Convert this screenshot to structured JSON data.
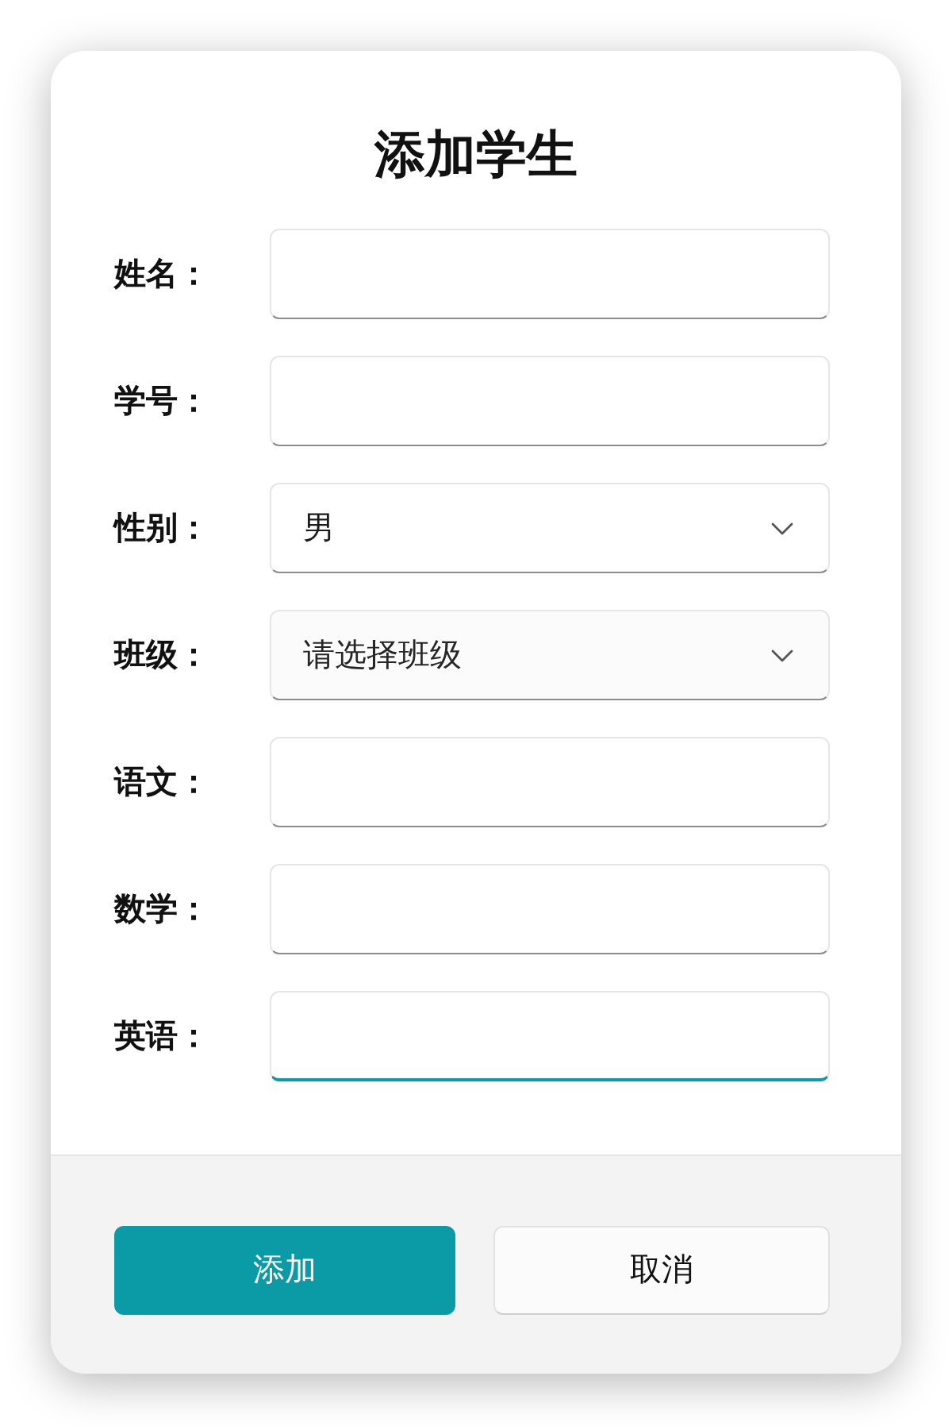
{
  "dialog": {
    "title": "添加学生"
  },
  "fields": [
    {
      "kind": "text",
      "label": "姓名：",
      "focused": false
    },
    {
      "kind": "text",
      "label": "学号：",
      "focused": false
    },
    {
      "kind": "select",
      "label": "性别：",
      "value": "男",
      "focused": false
    },
    {
      "kind": "select",
      "label": "班级：",
      "placeholder": "请选择班级",
      "focused": false
    },
    {
      "kind": "text",
      "label": "语文：",
      "focused": false
    },
    {
      "kind": "text",
      "label": "数学：",
      "focused": false
    },
    {
      "kind": "text",
      "label": "英语：",
      "focused": true
    }
  ],
  "buttons": [
    {
      "label": "添加",
      "kind": "primary"
    },
    {
      "label": "取消",
      "kind": "secondary"
    }
  ]
}
